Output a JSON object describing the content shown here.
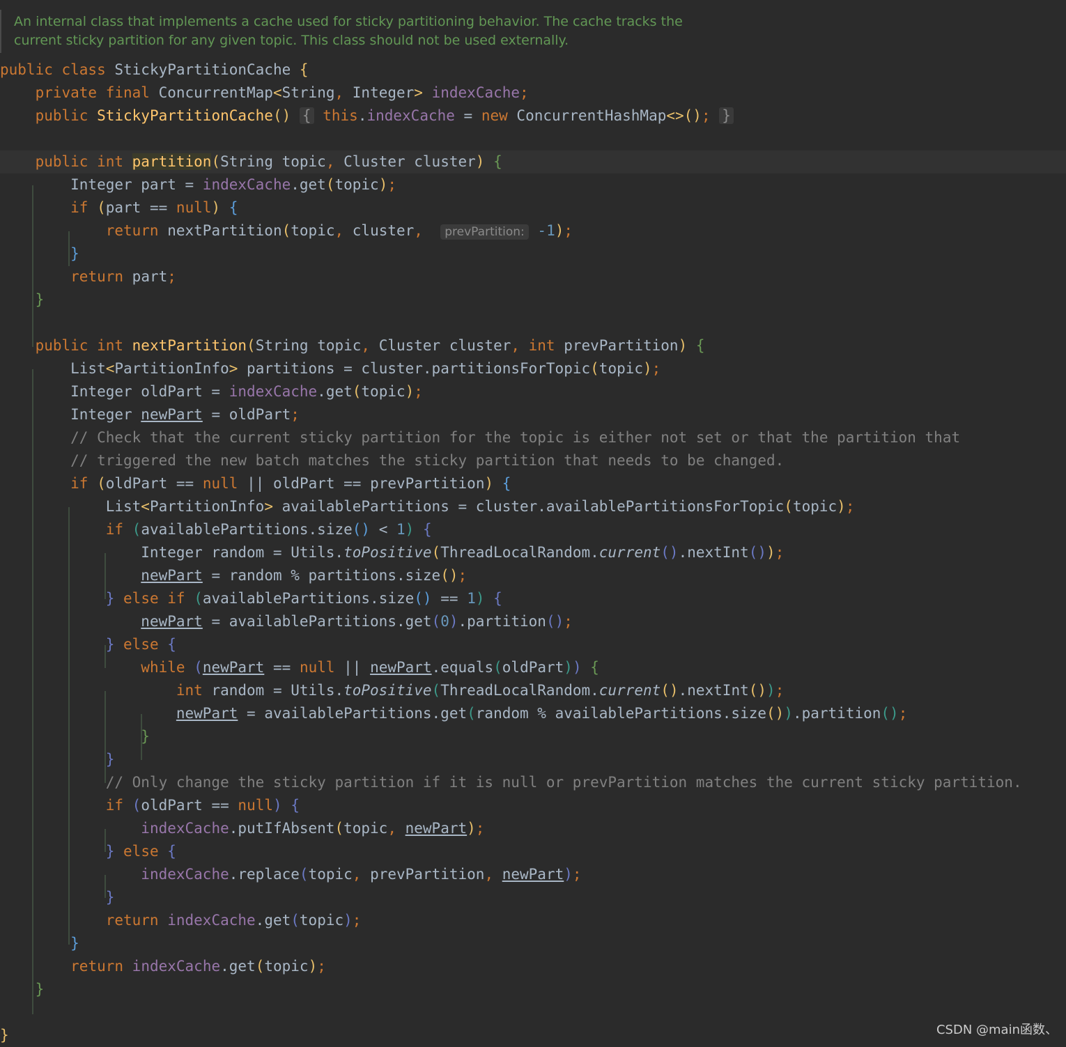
{
  "doc_comment": {
    "line1": "An internal class that implements a cache used for sticky partitioning behavior. The cache tracks the",
    "line2": "current sticky partition for any given topic. This class should not be used externally."
  },
  "inlay_hint": "prevPartition:",
  "comments": {
    "c1": "// Check that the current sticky partition for the topic is either not set or that the partition that",
    "c2": "// triggered the new batch matches the sticky partition that needs to be changed.",
    "c3": "// Only change the sticky partition if it is null or prevPartition matches the current sticky partition."
  },
  "names": {
    "class_name": "StickyPartitionCache",
    "field": "indexCache",
    "method1": "partition",
    "method2": "nextPartition"
  },
  "watermark": "CSDN @main函数、",
  "theme": {
    "background": "#2b2b2b",
    "keyword": "#cc7832",
    "field": "#9876aa",
    "method": "#ffc66d",
    "comment": "#808080",
    "doc": "#629755",
    "number": "#6897bb"
  }
}
